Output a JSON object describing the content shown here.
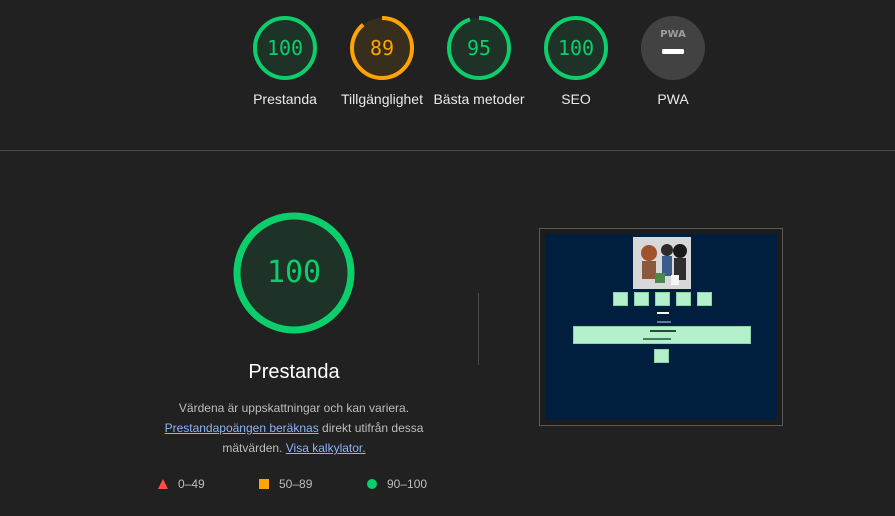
{
  "colors": {
    "pass": "#0cce6b",
    "average": "#ffa400",
    "fail": "#ff4e42",
    "pwa": "#9e9e9e",
    "background": "#212121",
    "link": "#8ab4f8"
  },
  "gauges": [
    {
      "score": "100",
      "label": "Prestanda",
      "status": "pass",
      "fraction": 1.0
    },
    {
      "score": "89",
      "label": "Tillgänglighet",
      "status": "average",
      "fraction": 0.89
    },
    {
      "score": "95",
      "label": "Bästa metoder",
      "status": "pass",
      "fraction": 0.95
    },
    {
      "score": "100",
      "label": "SEO",
      "status": "pass",
      "fraction": 1.0
    },
    {
      "score": "",
      "label": "PWA",
      "status": "pwa",
      "icon": "pwa-badge-icon",
      "badge_text": "PWA"
    }
  ],
  "main": {
    "score": "100",
    "fraction": 1.0,
    "title": "Prestanda",
    "desc_1": "Värdena är uppskattningar och kan variera.",
    "link_1": "Prestandapoängen beräknas",
    "desc_2": " direkt utifrån dessa mätvärden. ",
    "link_2": "Visa kalkylator."
  },
  "legend": [
    {
      "range": "0–49",
      "shape": "triangle-icon"
    },
    {
      "range": "50–89",
      "shape": "square-icon"
    },
    {
      "range": "90–100",
      "shape": "circle-icon"
    }
  ]
}
